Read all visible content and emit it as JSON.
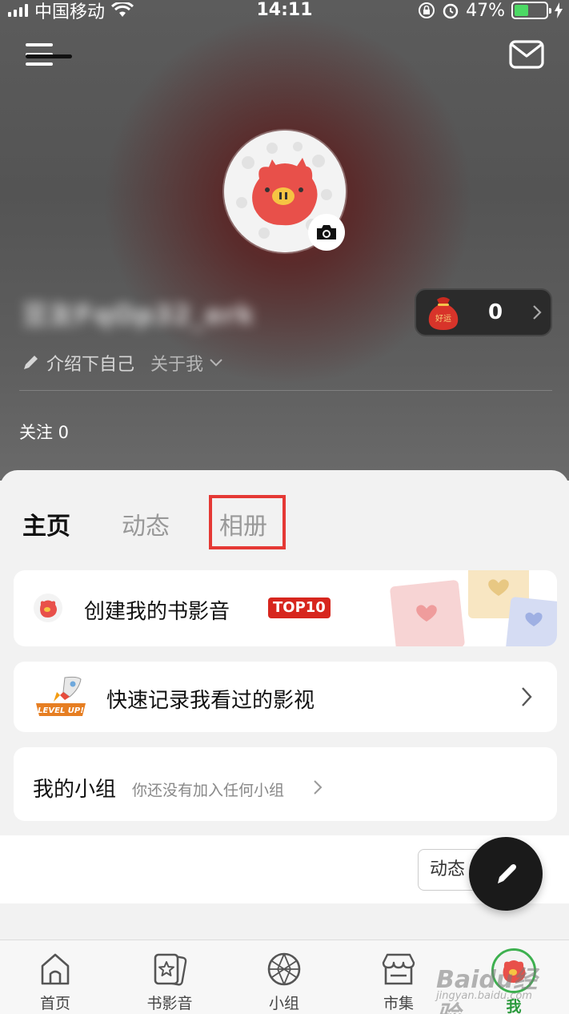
{
  "status_bar": {
    "carrier": "中国移动",
    "time": "14:11",
    "battery_percent": "47%",
    "battery_level": 0.47
  },
  "header": {
    "menu_icon": "hamburger-menu-icon",
    "mail_icon": "mail-icon"
  },
  "profile": {
    "username": "豆友FqOp32_erk",
    "coins": "0",
    "coin_bag_label": "好运",
    "intro": "介绍下自己",
    "about": "关于我",
    "following": "关注 0"
  },
  "tabs": [
    {
      "label": "主页",
      "active": true
    },
    {
      "label": "动态",
      "active": false
    },
    {
      "label": "相册",
      "active": false
    }
  ],
  "cards": {
    "create": {
      "title": "创建我的书影音",
      "badge": "TOP10"
    },
    "record": {
      "title": "快速记录我看过的影视",
      "logo_text": "LEVEL UP!"
    },
    "group": {
      "title": "我的小组",
      "subtitle": "你还没有加入任何小组"
    }
  },
  "feed": {
    "button_label": "动态"
  },
  "bottom_nav": [
    {
      "label": "首页",
      "icon": "home-icon"
    },
    {
      "label": "书影音",
      "icon": "star-card-icon"
    },
    {
      "label": "小组",
      "icon": "globe-icon"
    },
    {
      "label": "市集",
      "icon": "shop-icon"
    },
    {
      "label": "我",
      "icon": "avatar",
      "active": true
    }
  ],
  "watermark": {
    "text": "Baidu经验",
    "sub": "jingyan.baidu.com"
  },
  "colors": {
    "accent_green": "#2b9a3d",
    "highlight_red": "#e53935",
    "badge_red": "#d7261e"
  }
}
